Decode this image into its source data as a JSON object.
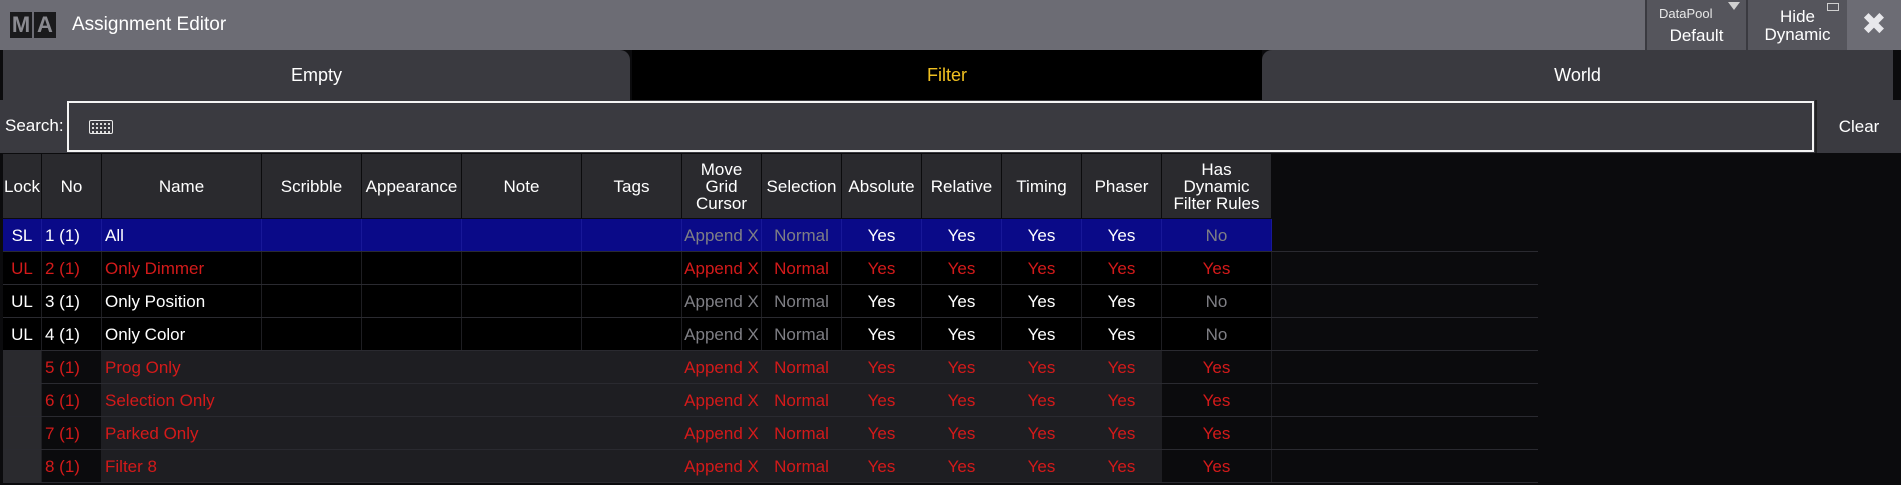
{
  "window": {
    "logo": [
      "M",
      "A"
    ],
    "title": "Assignment Editor",
    "datapool_label": "DataPool",
    "datapool_value": "Default",
    "hide_dynamic_line1": "Hide",
    "hide_dynamic_line2": "Dynamic",
    "close_glyph": "✖"
  },
  "tabs": [
    {
      "label": "Empty",
      "active": false
    },
    {
      "label": "Filter",
      "active": true
    },
    {
      "label": "World",
      "active": false
    }
  ],
  "search": {
    "label": "Search:",
    "value": "",
    "clear_label": "Clear",
    "icon": "keyboard-icon"
  },
  "table": {
    "columns": [
      {
        "key": "lock",
        "label": "Lock"
      },
      {
        "key": "no",
        "label": "No"
      },
      {
        "key": "name",
        "label": "Name"
      },
      {
        "key": "scribble",
        "label": "Scribble"
      },
      {
        "key": "appearance",
        "label": "Appearance"
      },
      {
        "key": "note",
        "label": "Note"
      },
      {
        "key": "tags",
        "label": "Tags"
      },
      {
        "key": "movegrid",
        "label": "Move Grid Cursor"
      },
      {
        "key": "selection",
        "label": "Selection"
      },
      {
        "key": "absolute",
        "label": "Absolute"
      },
      {
        "key": "relative",
        "label": "Relative"
      },
      {
        "key": "timing",
        "label": "Timing"
      },
      {
        "key": "phaser",
        "label": "Phaser"
      },
      {
        "key": "hasdyn",
        "label": "Has Dynamic Filter Rules"
      }
    ],
    "rows": [
      {
        "lock": "SL",
        "no": "1 (1)",
        "name": "All",
        "movegrid": "Append X",
        "selection": "Normal",
        "absolute": "Yes",
        "relative": "Yes",
        "timing": "Yes",
        "phaser": "Yes",
        "hasdyn": "No",
        "style": "selected"
      },
      {
        "lock": "UL",
        "no": "2 (1)",
        "name": "Only Dimmer",
        "movegrid": "Append X",
        "selection": "Normal",
        "absolute": "Yes",
        "relative": "Yes",
        "timing": "Yes",
        "phaser": "Yes",
        "hasdyn": "Yes",
        "style": "red-black"
      },
      {
        "lock": "UL",
        "no": "3 (1)",
        "name": "Only Position",
        "movegrid": "Append X",
        "selection": "Normal",
        "absolute": "Yes",
        "relative": "Yes",
        "timing": "Yes",
        "phaser": "Yes",
        "hasdyn": "No",
        "style": "white-black"
      },
      {
        "lock": "UL",
        "no": "4 (1)",
        "name": "Only Color",
        "movegrid": "Append X",
        "selection": "Normal",
        "absolute": "Yes",
        "relative": "Yes",
        "timing": "Yes",
        "phaser": "Yes",
        "hasdyn": "No",
        "style": "white-black"
      },
      {
        "lock": "",
        "no": "5 (1)",
        "name": "Prog Only",
        "movegrid": "Append X",
        "selection": "Normal",
        "absolute": "Yes",
        "relative": "Yes",
        "timing": "Yes",
        "phaser": "Yes",
        "hasdyn": "Yes",
        "style": "red-dark"
      },
      {
        "lock": "",
        "no": "6 (1)",
        "name": "Selection Only",
        "movegrid": "Append X",
        "selection": "Normal",
        "absolute": "Yes",
        "relative": "Yes",
        "timing": "Yes",
        "phaser": "Yes",
        "hasdyn": "Yes",
        "style": "red-dark"
      },
      {
        "lock": "",
        "no": "7 (1)",
        "name": "Parked Only",
        "movegrid": "Append X",
        "selection": "Normal",
        "absolute": "Yes",
        "relative": "Yes",
        "timing": "Yes",
        "phaser": "Yes",
        "hasdyn": "Yes",
        "style": "red-dark"
      },
      {
        "lock": "",
        "no": "8 (1)",
        "name": "Filter 8",
        "movegrid": "Append X",
        "selection": "Normal",
        "absolute": "Yes",
        "relative": "Yes",
        "timing": "Yes",
        "phaser": "Yes",
        "hasdyn": "Yes",
        "style": "red-dark"
      }
    ]
  },
  "colors": {
    "selected_row": "#0a0a88",
    "red_text": "#d41a1a",
    "active_tab_text": "#f0c020",
    "title_bar": "#6c6c74"
  }
}
